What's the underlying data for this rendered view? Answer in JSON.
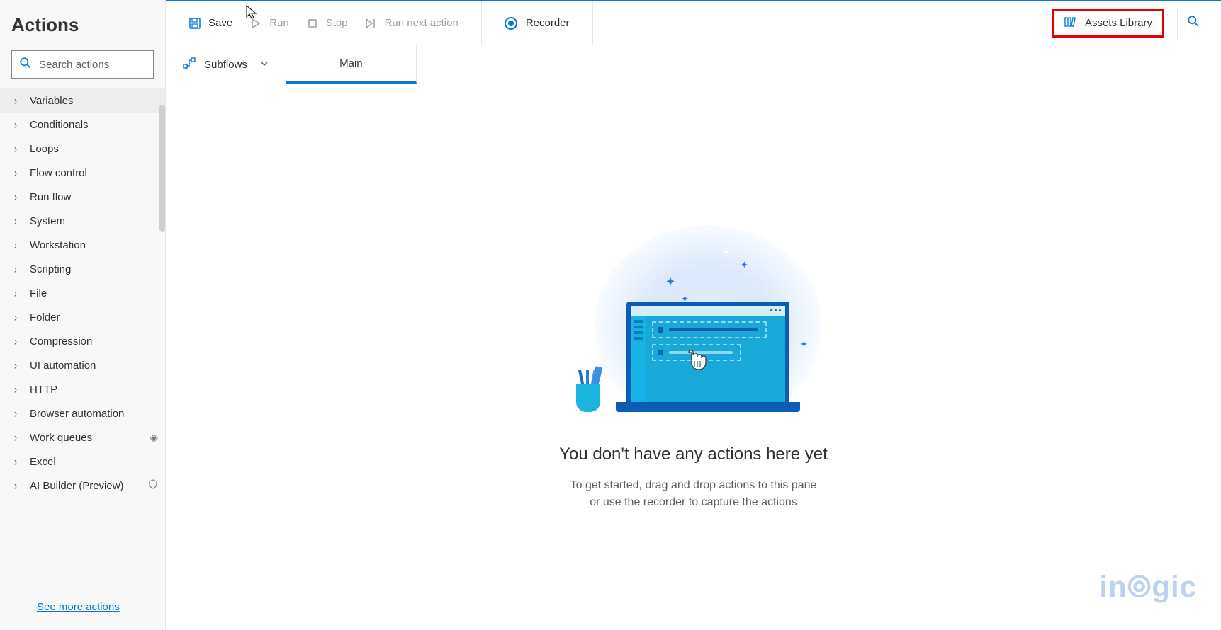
{
  "sidebar": {
    "title": "Actions",
    "search_placeholder": "Search actions",
    "see_more": "See more actions",
    "categories": [
      {
        "label": "Variables",
        "selected": true
      },
      {
        "label": "Conditionals"
      },
      {
        "label": "Loops"
      },
      {
        "label": "Flow control"
      },
      {
        "label": "Run flow"
      },
      {
        "label": "System"
      },
      {
        "label": "Workstation"
      },
      {
        "label": "Scripting"
      },
      {
        "label": "File"
      },
      {
        "label": "Folder"
      },
      {
        "label": "Compression"
      },
      {
        "label": "UI automation"
      },
      {
        "label": "HTTP"
      },
      {
        "label": "Browser automation"
      },
      {
        "label": "Work queues",
        "badge": "premium"
      },
      {
        "label": "Excel"
      },
      {
        "label": "AI Builder (Preview)",
        "badge": "shield"
      }
    ]
  },
  "toolbar": {
    "save": "Save",
    "run": "Run",
    "stop": "Stop",
    "run_next": "Run next action",
    "recorder": "Recorder",
    "assets_library": "Assets Library"
  },
  "tabs": {
    "subflows": "Subflows",
    "main": "Main"
  },
  "empty": {
    "title": "You don't have any actions here yet",
    "sub1": "To get started, drag and drop actions to this pane",
    "sub2": "or use the recorder to capture the actions"
  },
  "watermark": "inogic"
}
